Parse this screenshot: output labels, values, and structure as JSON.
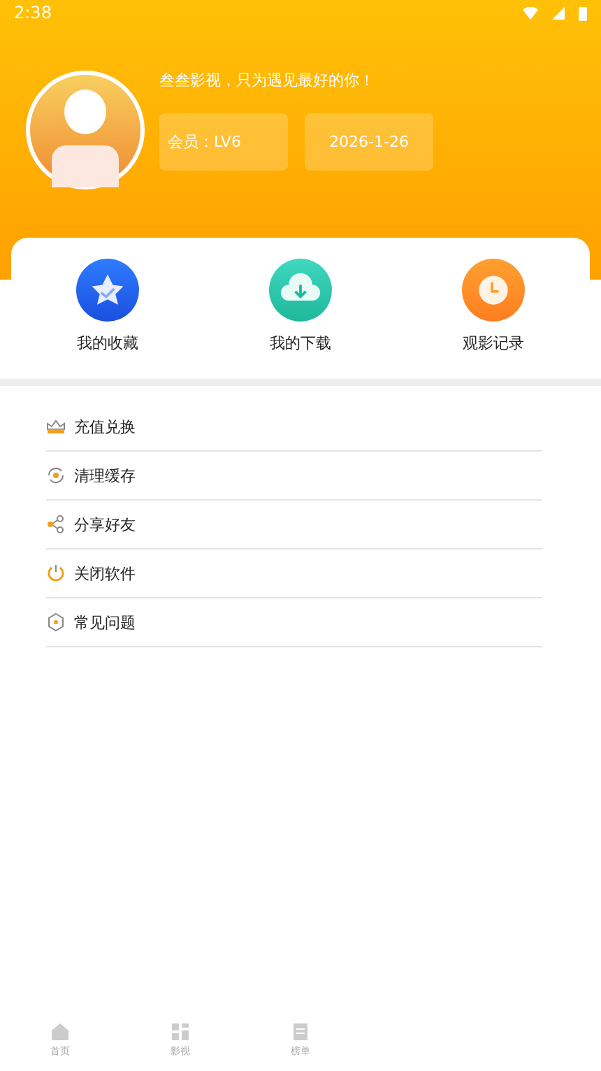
{
  "status_bar": {
    "time": "2:38"
  },
  "profile": {
    "slogan": "叁叁影视，只为遇见最好的你！",
    "member": "会员：LV6",
    "date": "2026-1-26"
  },
  "shortcuts": [
    {
      "kind": "favorites",
      "label": "我的收藏"
    },
    {
      "kind": "downloads",
      "label": "我的下载"
    },
    {
      "kind": "history",
      "label": "观影记录"
    }
  ],
  "menu": [
    {
      "kind": "recharge",
      "label": "充值兑换"
    },
    {
      "kind": "cache",
      "label": "清理缓存"
    },
    {
      "kind": "share",
      "label": "分享好友"
    },
    {
      "kind": "exit",
      "label": "关闭软件"
    },
    {
      "kind": "faq",
      "label": "常见问题"
    }
  ],
  "bottom_nav": [
    {
      "kind": "home",
      "label": "首页"
    },
    {
      "kind": "videos",
      "label": "影视"
    },
    {
      "kind": "ranking",
      "label": "榜单"
    }
  ]
}
